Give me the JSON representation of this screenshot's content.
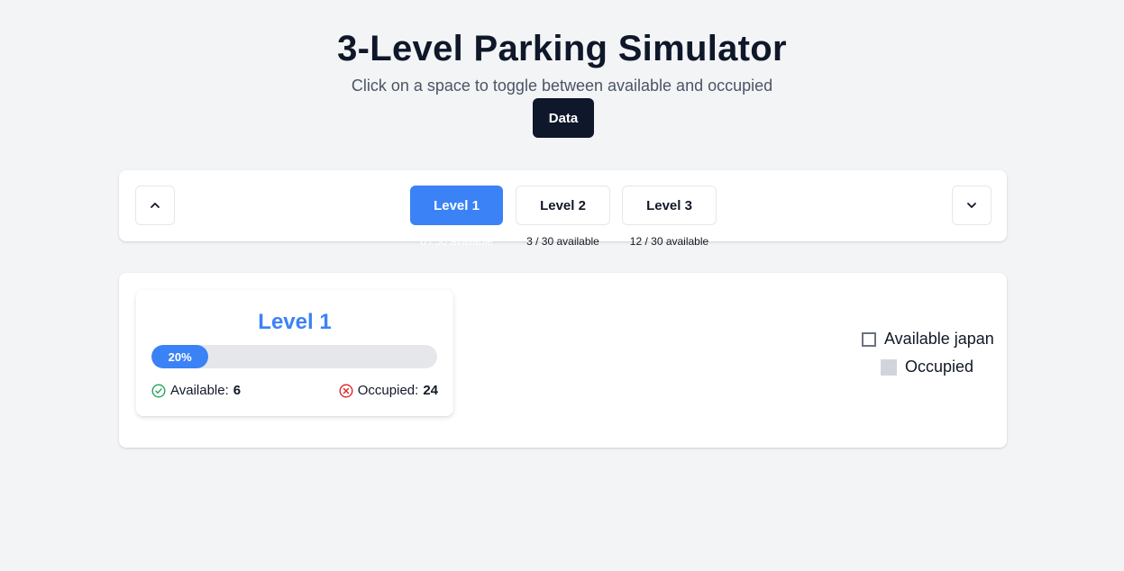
{
  "header": {
    "title": "3-Level Parking Simulator",
    "subtitle": "Click on a space to toggle between available and occupied",
    "data_button": "Data"
  },
  "level_bar": {
    "tabs": [
      {
        "label": "Level 1",
        "availability": "6 / 30 available",
        "active": true
      },
      {
        "label": "Level 2",
        "availability": "3 / 30 available",
        "active": false
      },
      {
        "label": "Level 3",
        "availability": "12 / 30 available",
        "active": false
      }
    ],
    "up_icon": "chevron-up-icon",
    "down_icon": "chevron-down-icon"
  },
  "level_card": {
    "title": "Level 1",
    "progress_fraction": 0.2,
    "progress_label": "20%",
    "available_label": "Available:",
    "available_count": "6",
    "occupied_label": "Occupied:",
    "occupied_count": "24",
    "available_icon": "check-circle-icon",
    "occupied_icon": "x-circle-icon"
  },
  "legend": {
    "available": "Available japan",
    "occupied": "Occupied"
  },
  "colors": {
    "accent": "#3b82f6",
    "dark_button": "#0f172a",
    "available_green": "#22a55a",
    "occupied_red": "#dc2626",
    "occupied_swatch": "#d1d5db"
  }
}
